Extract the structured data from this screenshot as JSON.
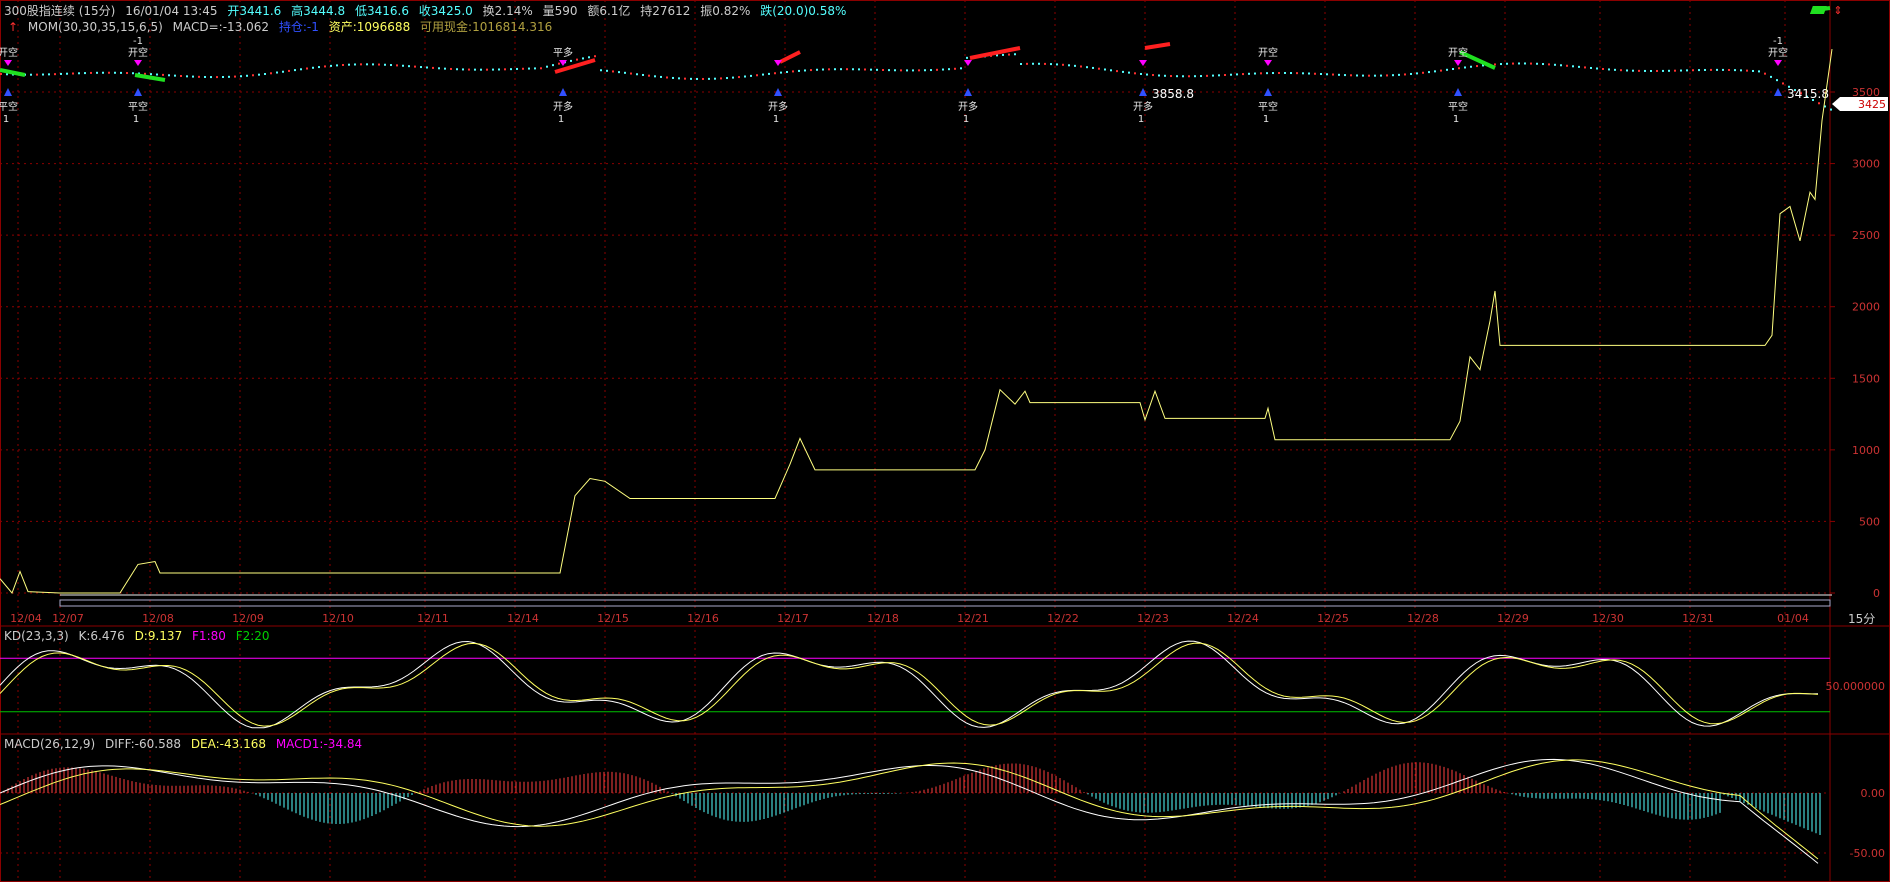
{
  "header": {
    "symbol": "300股指连续 (15分)",
    "datetime": "16/01/04 13:45",
    "open": "开3441.6",
    "high": "高3444.8",
    "low": "低3416.6",
    "close": "收3425.0",
    "turnover": "换2.14%",
    "volume": "量590",
    "amount": "额6.1亿",
    "hold": "持27612",
    "amplitude": "振0.82%",
    "change": "跌(20.0)0.58%"
  },
  "indicator_line": {
    "mom": "MOM(30,30,35,15,6,5)",
    "macd_val": "MACD=:-13.062",
    "position": "持仓:-1",
    "assets": "资产:1096688",
    "cash": "可用现金:1016814.316"
  },
  "kd_header": {
    "name": "KD(23,3,3)",
    "k": "K:6.476",
    "d": "D:9.137",
    "f1": "F1:80",
    "f2": "F2:20"
  },
  "macd_header": {
    "name": "MACD(26,12,9)",
    "diff": "DIFF:-60.588",
    "dea": "DEA:-43.168",
    "macd1": "MACD1:-34.84"
  },
  "period_label": "15分",
  "price_tag": "3425",
  "colors": {
    "price_up": "#ff3030",
    "price_down": "#54ffff",
    "equity": "#ffff80",
    "grid": "#8b0000",
    "kd_upper": "#ff00ff",
    "kd_lower": "#00c000",
    "macd_pos": "#ff4040",
    "macd_neg": "#54ffff"
  },
  "chart_data": [
    {
      "type": "line",
      "name": "main",
      "x_labels": [
        "12/04",
        "12/07",
        "12/08",
        "12/09",
        "12/10",
        "12/11",
        "12/14",
        "12/15",
        "12/16",
        "12/17",
        "12/18",
        "12/21",
        "12/22",
        "12/23",
        "12/24",
        "12/25",
        "12/28",
        "12/29",
        "12/30",
        "12/31",
        "01/04"
      ],
      "y_ticks": [
        0,
        500,
        1000,
        1500,
        2000,
        2500,
        3000,
        3500
      ],
      "ylim": [
        -80,
        4200
      ],
      "series": [
        {
          "values_xy": [
            [
              0,
              100
            ],
            [
              12,
              0
            ],
            [
              20,
              150
            ],
            [
              28,
              10
            ],
            [
              60,
              0
            ],
            [
              120,
              0
            ],
            [
              138,
              200
            ],
            [
              155,
              220
            ],
            [
              160,
              140
            ],
            [
              560,
              140
            ],
            [
              575,
              680
            ],
            [
              590,
              800
            ],
            [
              605,
              780
            ],
            [
              630,
              660
            ],
            [
              775,
              660
            ],
            [
              790,
              900
            ],
            [
              800,
              1080
            ],
            [
              815,
              860
            ],
            [
              975,
              860
            ],
            [
              985,
              1000
            ],
            [
              1000,
              1420
            ],
            [
              1015,
              1320
            ],
            [
              1025,
              1410
            ],
            [
              1030,
              1330
            ],
            [
              1140,
              1330
            ],
            [
              1145,
              1210
            ],
            [
              1155,
              1410
            ],
            [
              1165,
              1220
            ],
            [
              1265,
              1220
            ],
            [
              1268,
              1290
            ],
            [
              1275,
              1070
            ],
            [
              1450,
              1070
            ],
            [
              1460,
              1200
            ],
            [
              1470,
              1650
            ],
            [
              1480,
              1560
            ],
            [
              1490,
              1900
            ],
            [
              1495,
              2110
            ],
            [
              1500,
              1730
            ],
            [
              1765,
              1730
            ],
            [
              1772,
              1800
            ],
            [
              1780,
              2650
            ],
            [
              1790,
              2700
            ],
            [
              1800,
              2460
            ],
            [
              1810,
              2800
            ],
            [
              1815,
              2750
            ],
            [
              1822,
              3300
            ],
            [
              1832,
              3800
            ]
          ]
        },
        {
          "values_xy": [
            [
              60,
              0
            ],
            [
              1832,
              0
            ]
          ]
        }
      ]
    },
    {
      "type": "line",
      "name": "KD",
      "y_ticks_label": "50.000000",
      "upper": 80,
      "lower": 20
    },
    {
      "type": "bar",
      "name": "MACD",
      "y_ticks": [
        0,
        -50
      ],
      "y_tick_labels": [
        "0.00",
        "-50.00"
      ]
    }
  ],
  "signals": [
    {
      "x": 0,
      "label_top": "开空",
      "label_bot": "平空",
      "sub": "1"
    },
    {
      "x": 130,
      "label_top": "开空",
      "count": "-1",
      "label_bot": "平空",
      "sub": "1"
    },
    {
      "x": 555,
      "label_top": "平多",
      "label_bot": "开多",
      "sub": "1"
    },
    {
      "x": 770,
      "label_bot": "开多",
      "sub": "1"
    },
    {
      "x": 960,
      "label_bot": "开多",
      "sub": "1"
    },
    {
      "x": 1135,
      "label_bot": "开多",
      "sub": "1",
      "value": "3858.8"
    },
    {
      "x": 1260,
      "label_top": "开空",
      "label_bot": "平空",
      "sub": "1"
    },
    {
      "x": 1450,
      "label_top": "开空",
      "label_bot": "平空",
      "sub": "1"
    },
    {
      "x": 1770,
      "label_top": "开空",
      "count": "-1",
      "value": "3415.8"
    }
  ]
}
